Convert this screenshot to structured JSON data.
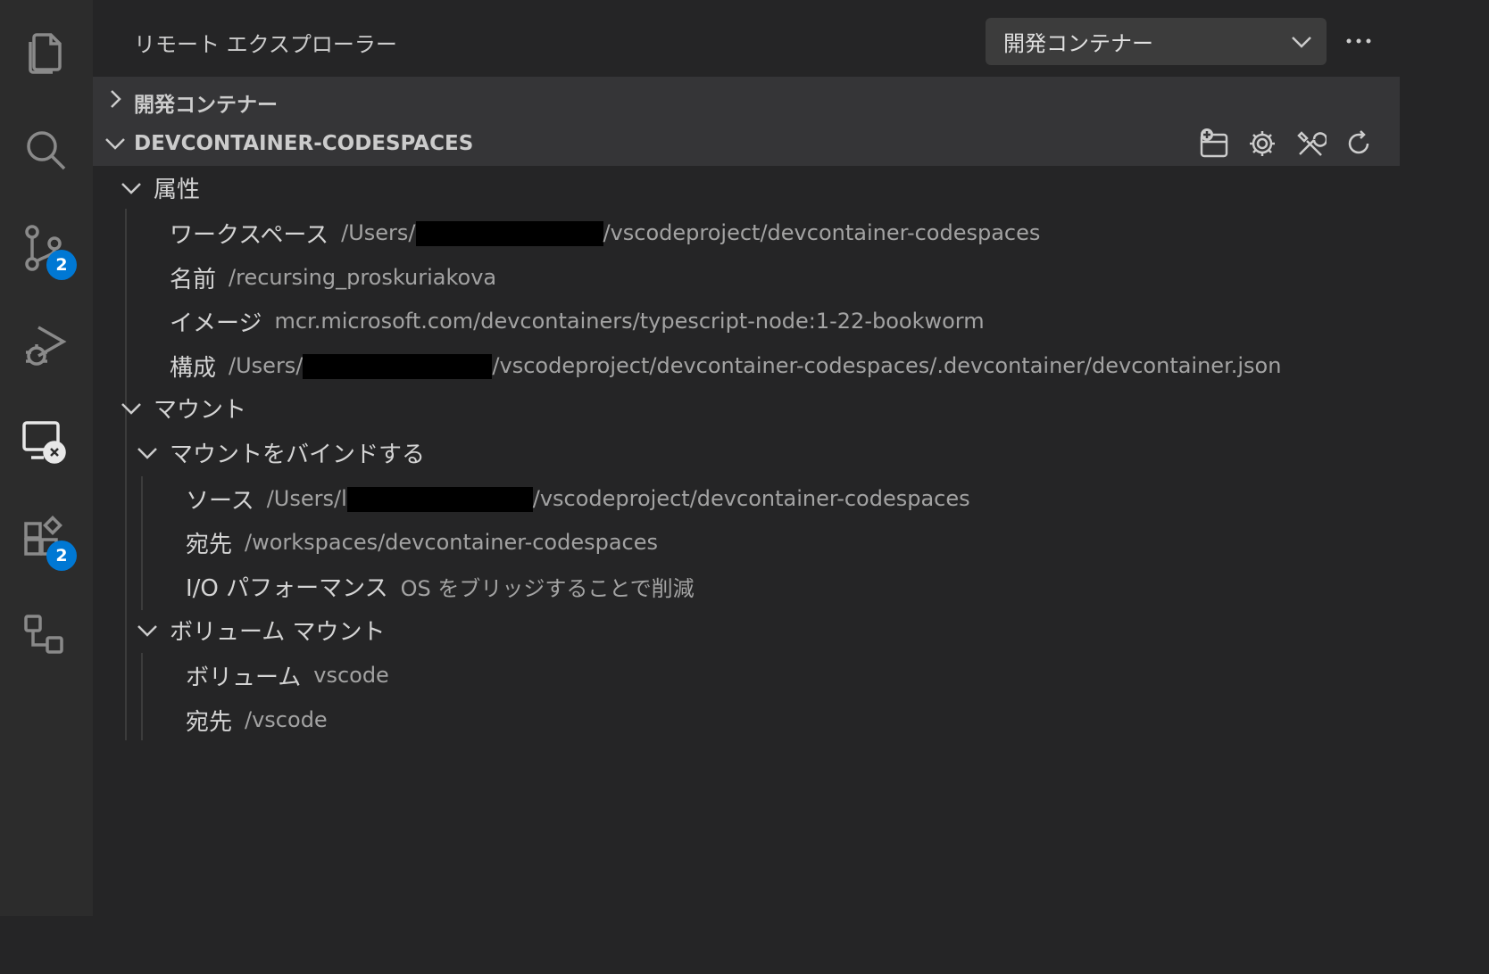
{
  "activity_bar": {
    "items": [
      {
        "icon": "files-icon"
      },
      {
        "icon": "search-icon"
      },
      {
        "icon": "source-control-icon",
        "badge": "2"
      },
      {
        "icon": "run-debug-icon"
      },
      {
        "icon": "remote-explorer-icon",
        "active": true
      },
      {
        "icon": "extensions-icon",
        "badge": "2"
      },
      {
        "icon": "containers-icon"
      }
    ]
  },
  "header": {
    "title": "リモート エクスプローラー",
    "dropdown_value": "開発コンテナー",
    "more_icon": "ellipsis-icon"
  },
  "sections": {
    "collapsed_label": "開発コンテナー",
    "expanded_label": "DEVCONTAINER-CODESPACES",
    "actions": [
      "new-dev-container-icon",
      "gear-icon",
      "tools-icon",
      "refresh-icon"
    ]
  },
  "tree": {
    "attributes": {
      "label": "属性",
      "workspace_key": "ワークスペース",
      "workspace_prefix": "/Users/",
      "workspace_suffix": "/vscodeproject/devcontainer-codespaces",
      "name_key": "名前",
      "name_value": "/recursing_proskuriakova",
      "image_key": "イメージ",
      "image_value": "mcr.microsoft.com/devcontainers/typescript-node:1-22-bookworm",
      "config_key": "構成",
      "config_prefix": "/Users/",
      "config_suffix": "/vscodeproject/devcontainer-codespaces/.devcontainer/devcontainer.json"
    },
    "mounts": {
      "label": "マウント",
      "bind": {
        "label": "マウントをバインドする",
        "source_key": "ソース",
        "source_prefix": "/Users/l",
        "source_suffix": "/vscodeproject/devcontainer-codespaces",
        "dest_key": "宛先",
        "dest_value": "/workspaces/devcontainer-codespaces",
        "io_key": "I/O パフォーマンス",
        "io_value": "OS をブリッジすることで削減"
      },
      "volume": {
        "label": "ボリューム マウント",
        "volume_key": "ボリューム",
        "volume_value": "vscode",
        "dest_key": "宛先",
        "dest_value": "/vscode"
      }
    }
  },
  "colors": {
    "activity_bar_bg": "#2c2c2c",
    "sidebar_bg": "#252526",
    "section_header_bg": "#353537",
    "badge": "#0078d4"
  }
}
